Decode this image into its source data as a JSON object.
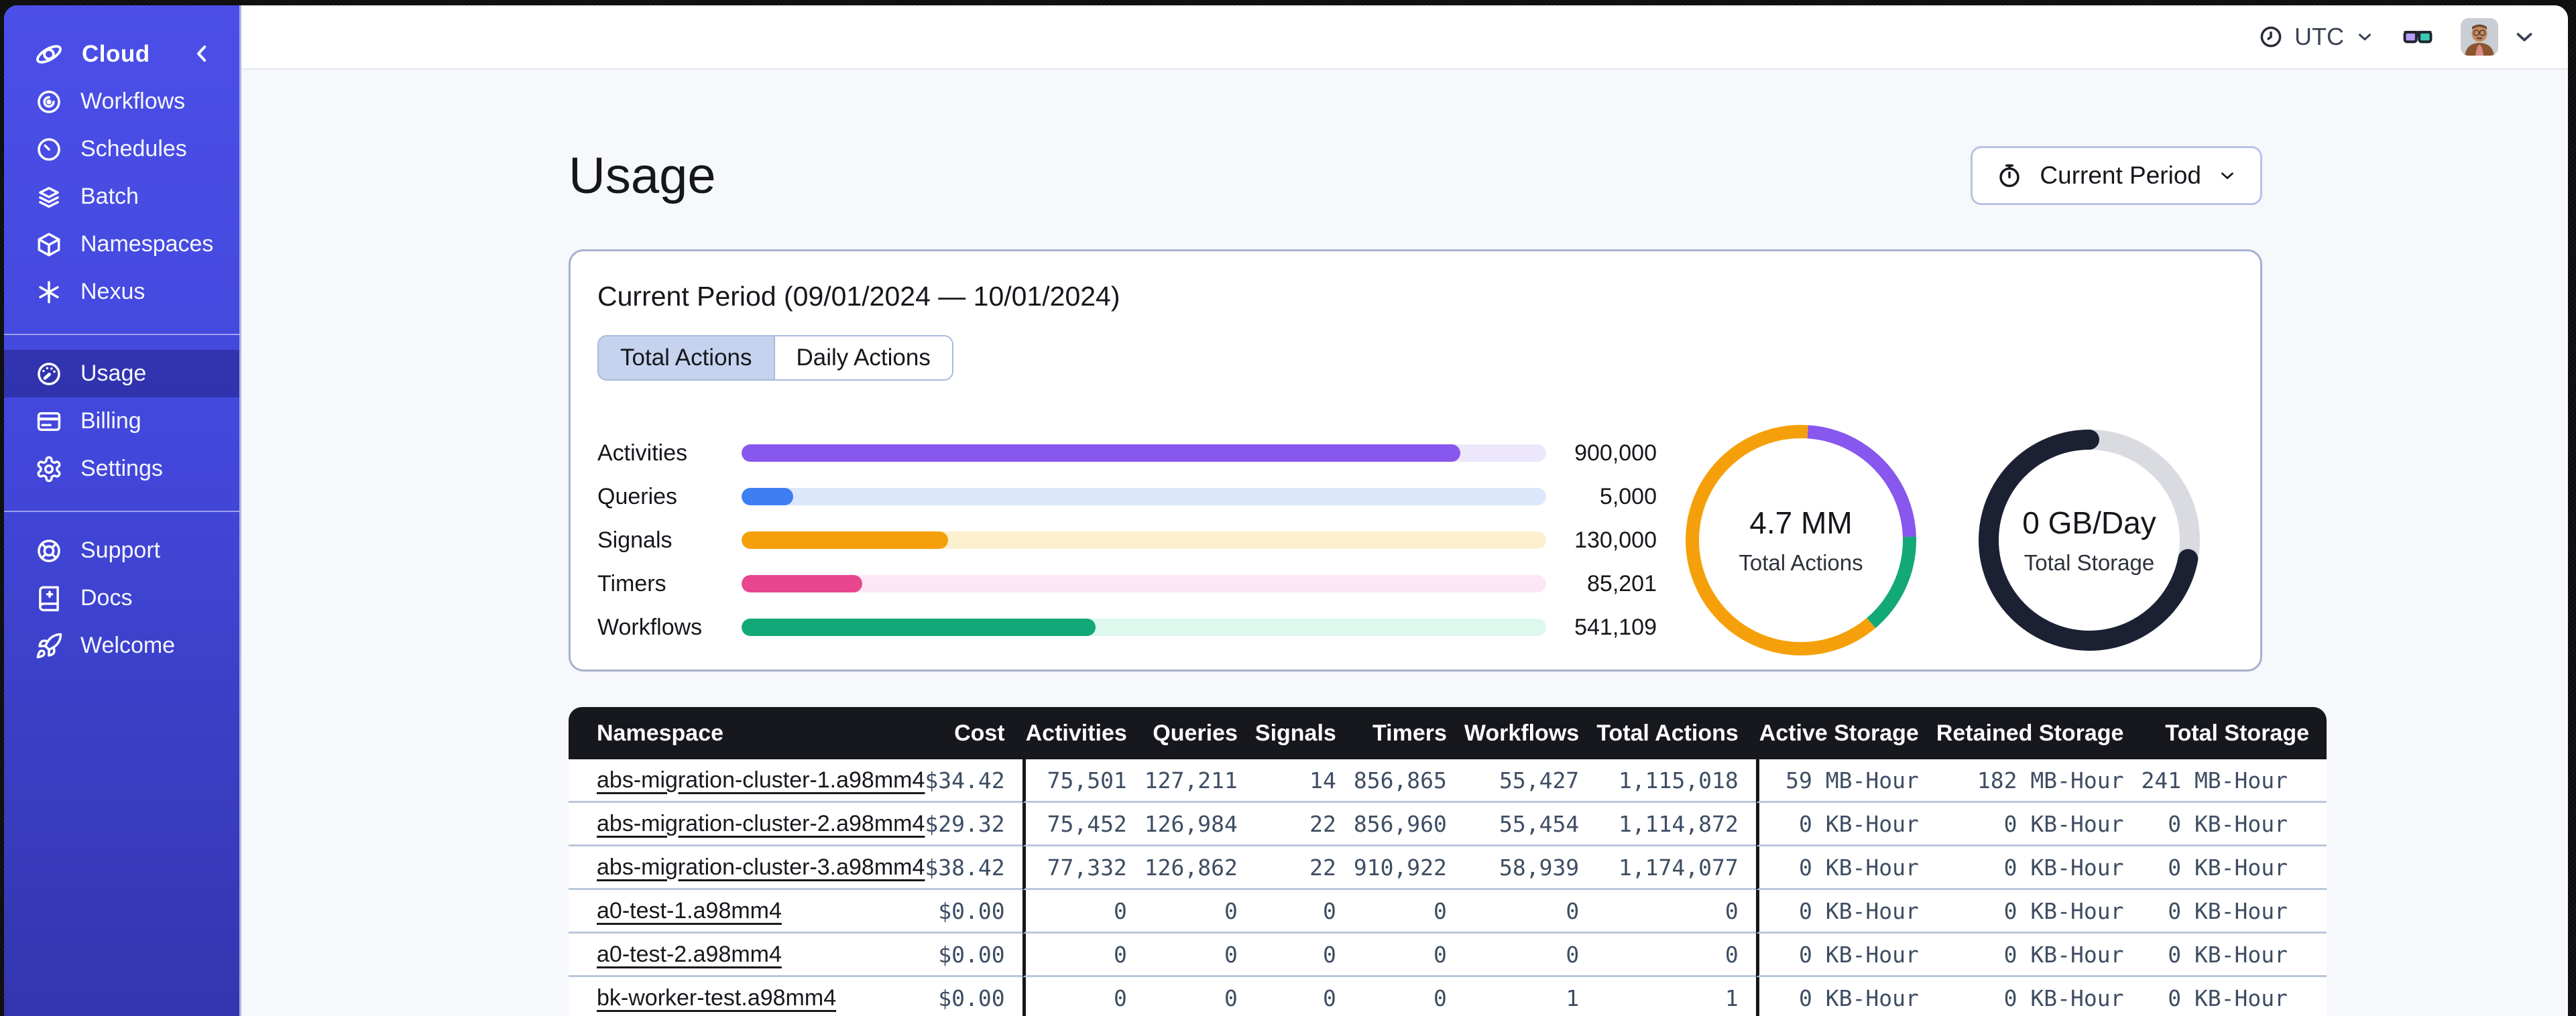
{
  "sidebar": {
    "brand_label": "Cloud",
    "sections": [
      {
        "items": [
          {
            "id": "workflows",
            "icon": "workflows",
            "label": "Workflows"
          },
          {
            "id": "schedules",
            "icon": "schedules",
            "label": "Schedules"
          },
          {
            "id": "batch",
            "icon": "batch",
            "label": "Batch"
          },
          {
            "id": "namespaces",
            "icon": "namespaces",
            "label": "Namespaces"
          },
          {
            "id": "nexus",
            "icon": "nexus",
            "label": "Nexus"
          }
        ]
      },
      {
        "items": [
          {
            "id": "usage",
            "icon": "usage",
            "label": "Usage",
            "selected": true
          },
          {
            "id": "billing",
            "icon": "billing",
            "label": "Billing"
          },
          {
            "id": "settings",
            "icon": "settings",
            "label": "Settings"
          }
        ]
      },
      {
        "items": [
          {
            "id": "support",
            "icon": "support",
            "label": "Support"
          },
          {
            "id": "docs",
            "icon": "docs",
            "label": "Docs"
          },
          {
            "id": "welcome",
            "icon": "welcome",
            "label": "Welcome"
          }
        ]
      }
    ]
  },
  "topbar": {
    "timezone": "UTC"
  },
  "page": {
    "title": "Usage",
    "period_button_label": "Current Period"
  },
  "usage_card": {
    "title": "Current Period (09/01/2024 — 10/01/2024)",
    "tabs": [
      {
        "label": "Total Actions",
        "selected": true
      },
      {
        "label": "Daily Actions",
        "selected": false
      }
    ]
  },
  "chart_data": [
    {
      "type": "bar",
      "title": "Current Period (09/01/2024 — 10/01/2024)",
      "categories": [
        "Activities",
        "Queries",
        "Signals",
        "Timers",
        "Workflows"
      ],
      "values": [
        900000,
        5000,
        130000,
        85201,
        541109
      ],
      "display_values": [
        "900,000",
        "5,000",
        "130,000",
        "85,201",
        "541,109"
      ],
      "fill_percent": [
        89.3,
        6.4,
        25.7,
        15.0,
        44.0
      ],
      "bar_colors": [
        "#8757EE",
        "#3D7FF2",
        "#F5A00A",
        "#E8468F",
        "#13A877"
      ],
      "track_colors": [
        "#EDE7FC",
        "#DBE7FB",
        "#FCF0CE",
        "#FCE7F6",
        "#DDF8EC"
      ]
    },
    {
      "type": "donut",
      "center_value": "4.7 MM",
      "center_label": "Total Actions",
      "start_offset_percent": 1,
      "segments": [
        {
          "name": "activities",
          "color": "#8757EE",
          "percent": 23.5
        },
        {
          "name": "workflows",
          "color": "#13A877",
          "percent": 14.3
        },
        {
          "name": "signals",
          "color": "#F5A00A",
          "percent": 62.2
        }
      ]
    },
    {
      "type": "donut",
      "center_value": "0 GB/Day",
      "center_label": "Total Storage",
      "start_offset_percent": 0,
      "segments": [
        {
          "name": "retained-storage",
          "color": "#D9DBE0",
          "percent": 28
        },
        {
          "name": "active-storage",
          "color": "#1B2133",
          "percent": 72,
          "linecap": "round"
        }
      ]
    }
  ],
  "table": {
    "columns": [
      {
        "label": "Namespace",
        "align": "left"
      },
      {
        "label": "Cost",
        "align": "right"
      },
      {
        "label": "Activities",
        "align": "right",
        "group_start": true
      },
      {
        "label": "Queries",
        "align": "right"
      },
      {
        "label": "Signals",
        "align": "right"
      },
      {
        "label": "Timers",
        "align": "right"
      },
      {
        "label": "Workflows",
        "align": "right"
      },
      {
        "label": "Total Actions",
        "align": "right"
      },
      {
        "label": "Active Storage",
        "align": "right",
        "group_start": true
      },
      {
        "label": "Retained Storage",
        "align": "right"
      },
      {
        "label": "Total Storage",
        "align": "right"
      }
    ],
    "rows": [
      {
        "namespace": "abs-migration-cluster-1.a98mm4",
        "cells": [
          "$34.42",
          "75,501",
          "127,211",
          "14",
          "856,865",
          "55,427",
          "1,115,018",
          "59 MB-Hour",
          "182 MB-Hour",
          "241 MB-Hour"
        ]
      },
      {
        "namespace": "abs-migration-cluster-2.a98mm4",
        "cells": [
          "$29.32",
          "75,452",
          "126,984",
          "22",
          "856,960",
          "55,454",
          "1,114,872",
          "0 KB-Hour",
          "0 KB-Hour",
          "0 KB-Hour"
        ]
      },
      {
        "namespace": "abs-migration-cluster-3.a98mm4",
        "cells": [
          "$38.42",
          "77,332",
          "126,862",
          "22",
          "910,922",
          "58,939",
          "1,174,077",
          "0 KB-Hour",
          "0 KB-Hour",
          "0 KB-Hour"
        ]
      },
      {
        "namespace": "a0-test-1.a98mm4",
        "cells": [
          "$0.00",
          "0",
          "0",
          "0",
          "0",
          "0",
          "0",
          "0 KB-Hour",
          "0 KB-Hour",
          "0 KB-Hour"
        ]
      },
      {
        "namespace": "a0-test-2.a98mm4",
        "cells": [
          "$0.00",
          "0",
          "0",
          "0",
          "0",
          "0",
          "0",
          "0 KB-Hour",
          "0 KB-Hour",
          "0 KB-Hour"
        ]
      },
      {
        "namespace": "bk-worker-test.a98mm4",
        "cells": [
          "$0.00",
          "0",
          "0",
          "0",
          "0",
          "1",
          "1",
          "0 KB-Hour",
          "0 KB-Hour",
          "0 KB-Hour"
        ]
      }
    ]
  }
}
